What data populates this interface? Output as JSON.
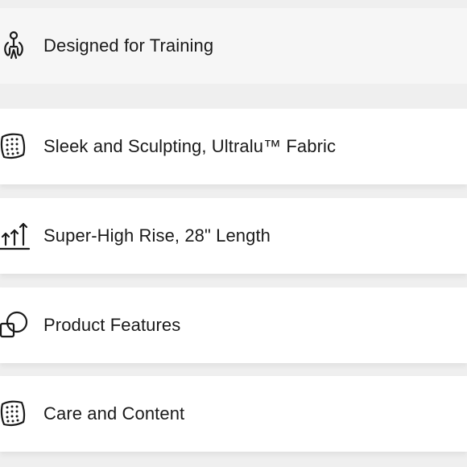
{
  "features": [
    {
      "label": "Designed for Training",
      "icon": "training-person-icon"
    },
    {
      "label": "Sleek and Sculpting, Ultralu™ Fabric",
      "icon": "fabric-swatch-icon"
    },
    {
      "label": "Super-High Rise, 28\" Length",
      "icon": "rise-arrows-icon"
    },
    {
      "label": "Product Features",
      "icon": "product-features-icon"
    },
    {
      "label": "Care and Content",
      "icon": "fabric-swatch-icon"
    }
  ]
}
